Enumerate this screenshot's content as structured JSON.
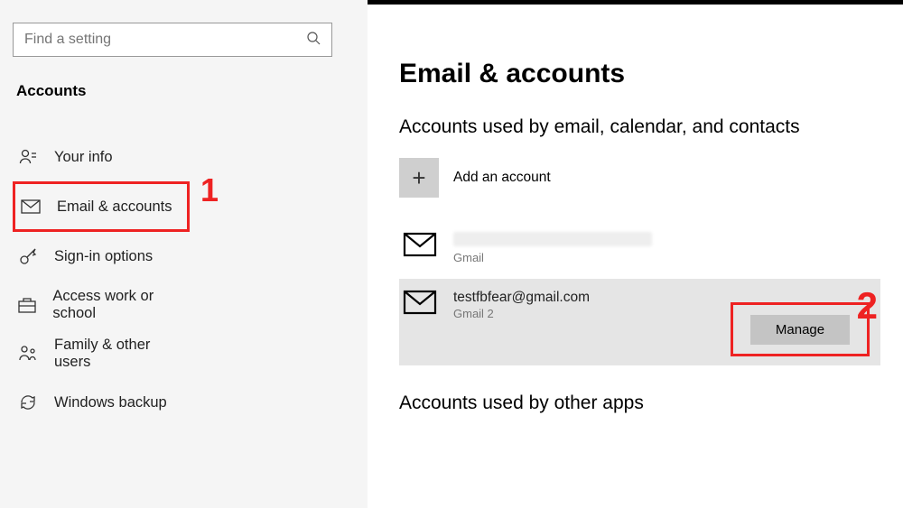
{
  "sidebar": {
    "search_placeholder": "Find a setting",
    "title": "Accounts",
    "items": [
      {
        "label": "Your info"
      },
      {
        "label": "Email & accounts"
      },
      {
        "label": "Sign-in options"
      },
      {
        "label": "Access work or school"
      },
      {
        "label": "Family & other users"
      },
      {
        "label": "Windows backup"
      }
    ]
  },
  "main": {
    "title": "Email & accounts",
    "section1_title": "Accounts used by email, calendar, and contacts",
    "add_label": "Add an account",
    "account1": {
      "email": "",
      "provider": "Gmail"
    },
    "account2": {
      "email": "testfbfear@gmail.com",
      "provider": "Gmail 2"
    },
    "manage_label": "Manage",
    "section2_title": "Accounts used by other apps"
  },
  "annotations": {
    "one": "1",
    "two": "2"
  }
}
